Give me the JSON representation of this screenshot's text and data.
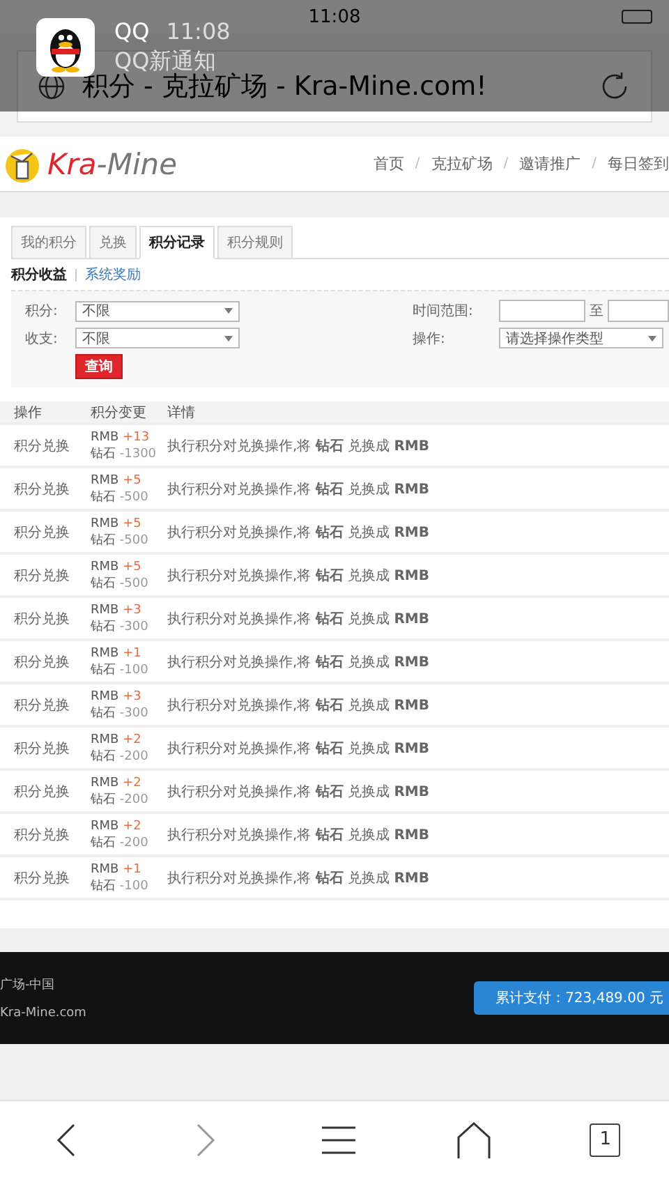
{
  "status_bar": {
    "time": "11:08"
  },
  "notification": {
    "app": "QQ",
    "time": "11:08",
    "message": "QQ新通知"
  },
  "address_bar": {
    "title": "积分 - 克拉矿场 - Kra-Mine.com!"
  },
  "site_header": {
    "logo_brand": "Kra",
    "logo_rest": "-Mine",
    "nav": [
      "首页",
      "克拉矿场",
      "邀请推广",
      "每日签到"
    ],
    "separator": "/"
  },
  "tabs": [
    {
      "label": "我的积分",
      "selected": false
    },
    {
      "label": "兑换",
      "selected": false
    },
    {
      "label": "积分记录",
      "selected": true
    },
    {
      "label": "积分规则",
      "selected": false
    }
  ],
  "subnav": [
    {
      "label": "积分收益",
      "selected": true
    },
    {
      "label": "系统奖励",
      "selected": false
    }
  ],
  "filters": {
    "left": [
      {
        "label": "积分:",
        "value": "不限"
      },
      {
        "label": "收支:",
        "value": "不限"
      }
    ],
    "time_label": "时间范围:",
    "time_to": "至",
    "op_label": "操作:",
    "op_placeholder": "请选择操作类型",
    "query_button": "查询"
  },
  "table": {
    "columns": [
      "操作",
      "积分变更",
      "详情"
    ],
    "rows": [
      {
        "op": "积分兑换",
        "gain_unit": "RMB",
        "gain": "+13",
        "cost_unit": "钻石",
        "cost": "-1300",
        "detail": "执行积分对兑换操作,将 **钻石** 兑换成 **RMB**"
      },
      {
        "op": "积分兑换",
        "gain_unit": "RMB",
        "gain": "+5",
        "cost_unit": "钻石",
        "cost": "-500",
        "detail": "执行积分对兑换操作,将 **钻石** 兑换成 **RMB**"
      },
      {
        "op": "积分兑换",
        "gain_unit": "RMB",
        "gain": "+5",
        "cost_unit": "钻石",
        "cost": "-500",
        "detail": "执行积分对兑换操作,将 **钻石** 兑换成 **RMB**"
      },
      {
        "op": "积分兑换",
        "gain_unit": "RMB",
        "gain": "+5",
        "cost_unit": "钻石",
        "cost": "-500",
        "detail": "执行积分对兑换操作,将 **钻石** 兑换成 **RMB**"
      },
      {
        "op": "积分兑换",
        "gain_unit": "RMB",
        "gain": "+3",
        "cost_unit": "钻石",
        "cost": "-300",
        "detail": "执行积分对兑换操作,将 **钻石** 兑换成 **RMB**"
      },
      {
        "op": "积分兑换",
        "gain_unit": "RMB",
        "gain": "+1",
        "cost_unit": "钻石",
        "cost": "-100",
        "detail": "执行积分对兑换操作,将 **钻石** 兑换成 **RMB**"
      },
      {
        "op": "积分兑换",
        "gain_unit": "RMB",
        "gain": "+3",
        "cost_unit": "钻石",
        "cost": "-300",
        "detail": "执行积分对兑换操作,将 **钻石** 兑换成 **RMB**"
      },
      {
        "op": "积分兑换",
        "gain_unit": "RMB",
        "gain": "+2",
        "cost_unit": "钻石",
        "cost": "-200",
        "detail": "执行积分对兑换操作,将 **钻石** 兑换成 **RMB**"
      },
      {
        "op": "积分兑换",
        "gain_unit": "RMB",
        "gain": "+2",
        "cost_unit": "钻石",
        "cost": "-200",
        "detail": "执行积分对兑换操作,将 **钻石** 兑换成 **RMB**"
      },
      {
        "op": "积分兑换",
        "gain_unit": "RMB",
        "gain": "+2",
        "cost_unit": "钻石",
        "cost": "-200",
        "detail": "执行积分对兑换操作,将 **钻石** 兑换成 **RMB**"
      },
      {
        "op": "积分兑换",
        "gain_unit": "RMB",
        "gain": "+1",
        "cost_unit": "钻石",
        "cost": "-100",
        "detail": "执行积分对兑换操作,将 **钻石** 兑换成 **RMB**"
      }
    ]
  },
  "footer": {
    "lines": [
      "广场-中国",
      "Kra-Mine.com"
    ],
    "total_button": "累计支付：723,489.00 元"
  },
  "bottom_nav": {
    "tab_count": "1"
  }
}
